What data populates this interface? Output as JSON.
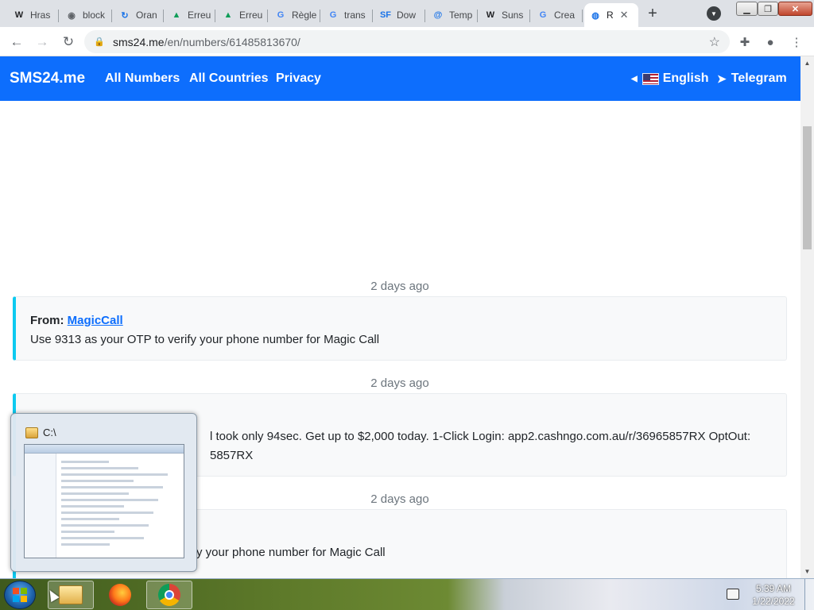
{
  "browser": {
    "tabs": [
      {
        "label": "Hras",
        "icon": "wikipedia-icon",
        "glyph": "W",
        "color": "#202124"
      },
      {
        "label": "block",
        "icon": "globe-icon",
        "glyph": "◉",
        "color": "#5f6368"
      },
      {
        "label": "Oran",
        "icon": "orange-icon",
        "glyph": "↻",
        "color": "#1a73e8"
      },
      {
        "label": "Erreu",
        "icon": "google-drive-icon",
        "glyph": "▲",
        "color": "#0f9d58"
      },
      {
        "label": "Erreu",
        "icon": "google-drive-icon",
        "glyph": "▲",
        "color": "#0f9d58"
      },
      {
        "label": "Règle",
        "icon": "google-icon",
        "glyph": "G",
        "color": "#4285f4"
      },
      {
        "label": "trans",
        "icon": "google-icon",
        "glyph": "G",
        "color": "#4285f4"
      },
      {
        "label": "Dow",
        "icon": "sourceforge-icon",
        "glyph": "SF",
        "color": "#1a73e8"
      },
      {
        "label": "Temp",
        "icon": "at-icon",
        "glyph": "@",
        "color": "#1a73e8"
      },
      {
        "label": "Suns",
        "icon": "wikipedia-icon",
        "glyph": "W",
        "color": "#202124"
      },
      {
        "label": "Crea",
        "icon": "google-icon",
        "glyph": "G",
        "color": "#4285f4"
      },
      {
        "label": "R",
        "icon": "sms24-icon",
        "glyph": "◍",
        "color": "#1a73e8"
      }
    ],
    "new_tab": "+",
    "url_host": "sms24.me",
    "url_path": "/en/numbers/61485813670/"
  },
  "site": {
    "brand": "SMS24.me",
    "nav": [
      "All Numbers",
      "All Countries",
      "Privacy"
    ],
    "language": "English",
    "telegram": "Telegram",
    "accent": "#0d6efd"
  },
  "messages": [
    {
      "time": "2 days ago",
      "from_label": "From:",
      "sender": "MagicCall",
      "text": "Use 9313 as your OTP to verify your phone number for Magic Call"
    },
    {
      "time": "2 days ago",
      "text_line1": "l took only 94sec. Get up to $2,000 today. 1-Click Login: app2.cashngo.com.au/r/36965857RX OptOut:",
      "text_line2": "5857RX"
    },
    {
      "time": "2 days ago",
      "text": "y your phone number for Magic Call"
    }
  ],
  "preview": {
    "title": "C:\\"
  },
  "taskbar": {
    "clock_time": "5:39 AM",
    "clock_date": "1/22/2022"
  }
}
